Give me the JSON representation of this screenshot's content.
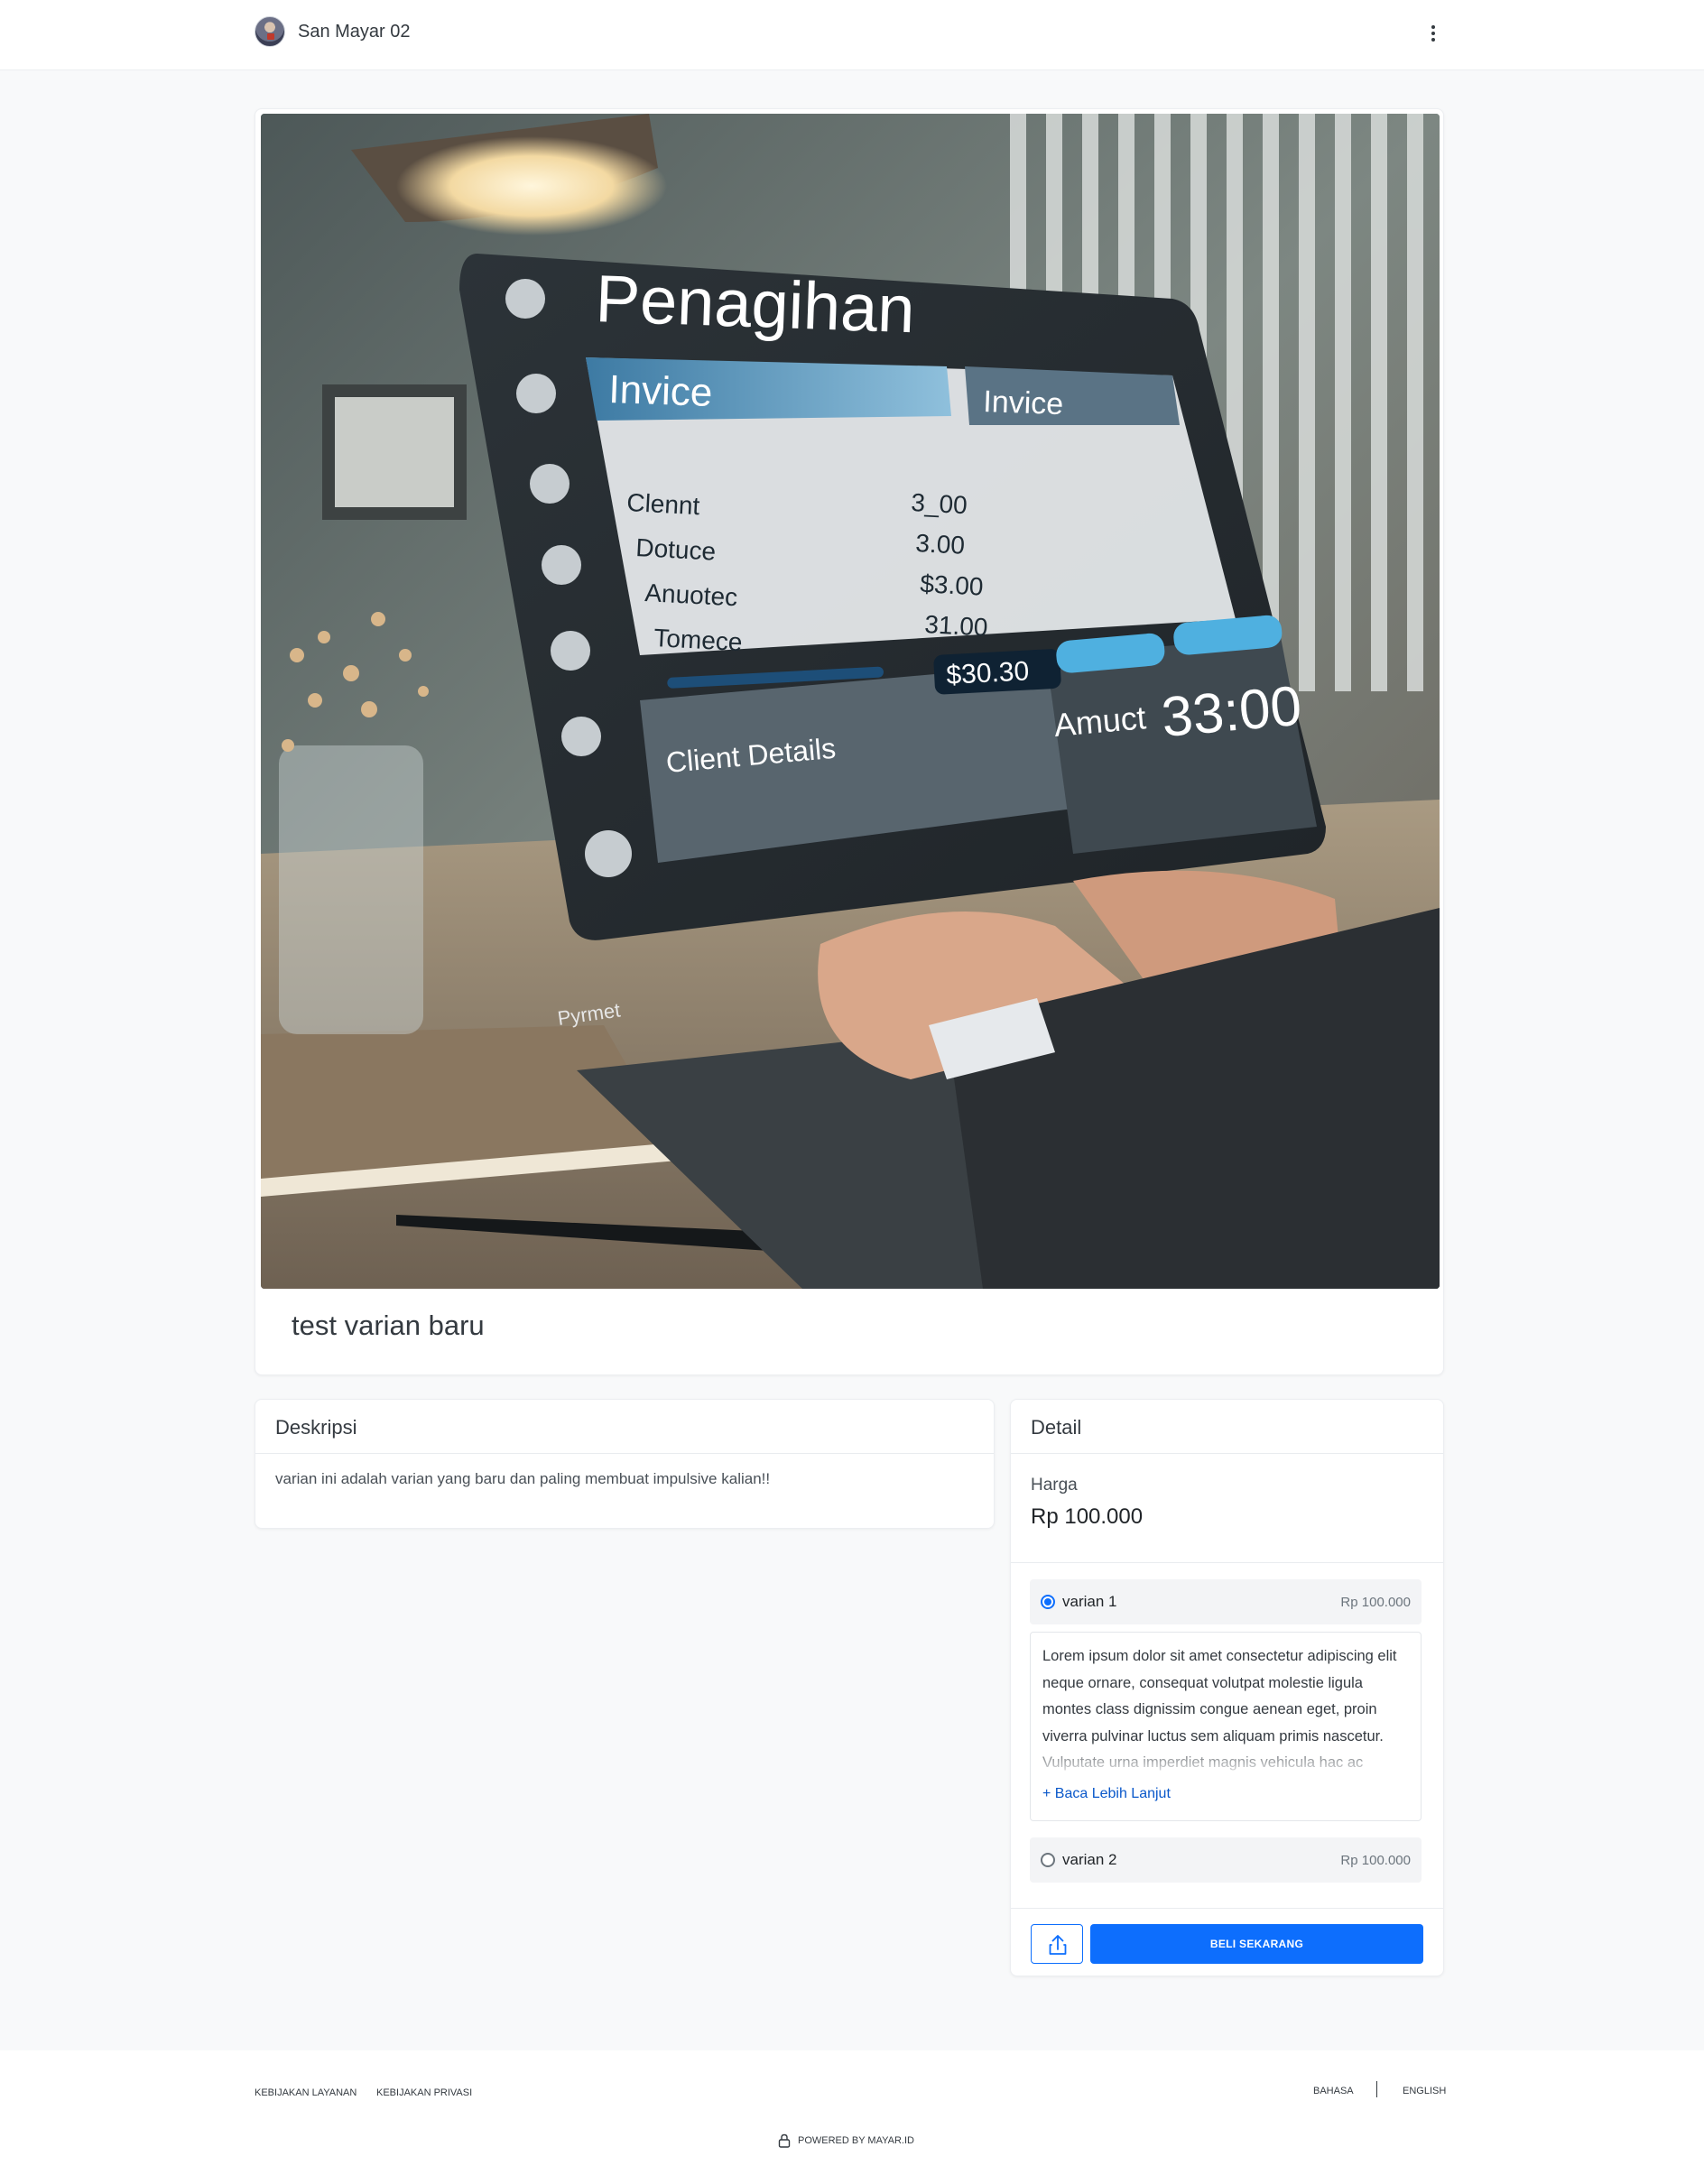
{
  "header": {
    "store_name": "San Mayar 02"
  },
  "product": {
    "title": "test varian baru",
    "image_alt": "Penagihan invoice dashboard on monitor",
    "image_text": {
      "screen_title": "Penagihan",
      "panel_left_title": "Invice",
      "panel_right_title": "Invice",
      "rows": [
        "Clennt",
        "Dotuce",
        "Anuotec",
        "Tomece"
      ],
      "values": [
        "3_00",
        "3.00",
        "$3.00",
        "31.00"
      ],
      "total": "$30.30",
      "client_details": "Client Details",
      "amount_big": "33:00",
      "amount_label": "Amuct",
      "payment": "Pyrmet"
    }
  },
  "description": {
    "heading": "Deskripsi",
    "text": "varian ini adalah varian yang baru dan paling membuat impulsive kalian!!"
  },
  "detail": {
    "heading": "Detail",
    "price_label": "Harga",
    "price_value": "Rp 100.000",
    "variants": [
      {
        "name": "varian 1",
        "price": "Rp 100.000",
        "selected": true,
        "description": "Lorem ipsum dolor sit amet consectetur adipiscing elit neque ornare, consequat volutpat molestie ligula montes class dignissim congue aenean eget, proin viverra pulvinar luctus sem aliquam primis nascetur. Vulputate urna imperdiet magnis vehicula hac ac",
        "read_more": "+ Baca Lebih Lanjut"
      },
      {
        "name": "varian 2",
        "price": "Rp 100.000",
        "selected": false
      }
    ],
    "buy_label": "BELI SEKARANG",
    "share_icon": "share-icon"
  },
  "footer": {
    "terms": "KEBIJAKAN LAYANAN",
    "privacy": "KEBIJAKAN PRIVASI",
    "language_label": "BAHASA",
    "language_value": "ENGLISH",
    "powered_by": "POWERED BY MAYAR.ID"
  },
  "colors": {
    "accent": "#0d6efd",
    "background": "#f8f9fa"
  }
}
